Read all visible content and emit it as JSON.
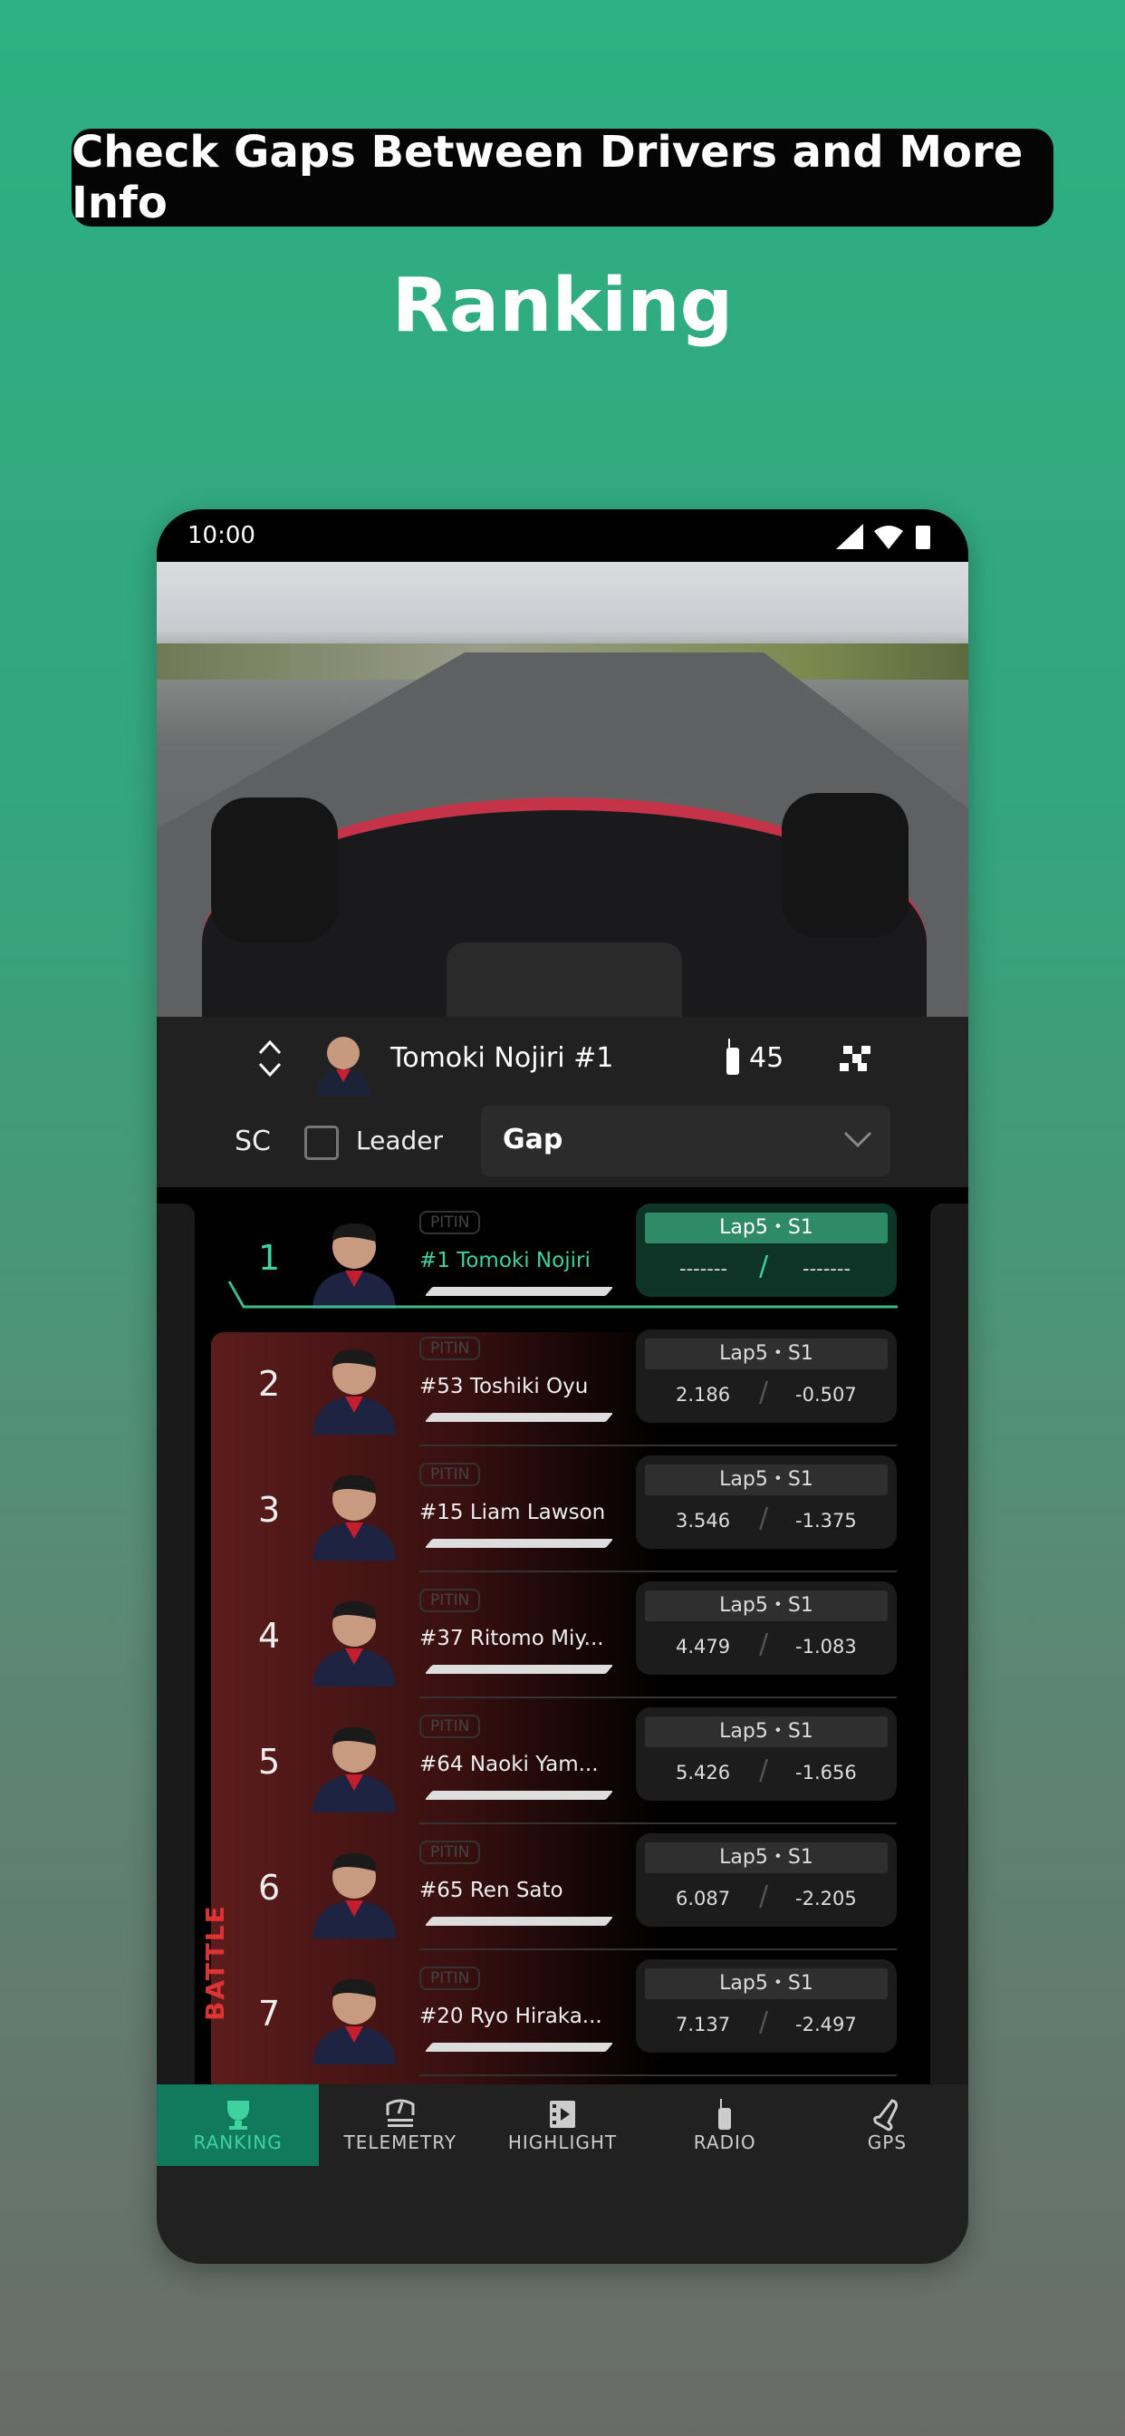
{
  "banner": "Check Gaps Between Drivers and More Info",
  "title": "Ranking",
  "status": {
    "time": "10:00"
  },
  "header": {
    "driver": "Tomoki Nojiri #1",
    "radio_count": "45"
  },
  "filter": {
    "sc": "SC",
    "leader": "Leader",
    "leader_checked": false,
    "mode": "Gap"
  },
  "battle_label": "BATTLE",
  "accent": "#2db083",
  "rows": [
    {
      "pos": "1",
      "pit": "PITIN",
      "name": "#1 Tomoki Nojiri",
      "lap": "Lap5・S1",
      "gap": "-------",
      "diff": "-------",
      "leader": true
    },
    {
      "pos": "2",
      "pit": "PITIN",
      "name": "#53 Toshiki Oyu",
      "lap": "Lap5・S1",
      "gap": "2.186",
      "diff": "-0.507"
    },
    {
      "pos": "3",
      "pit": "PITIN",
      "name": "#15 Liam Lawson",
      "lap": "Lap5・S1",
      "gap": "3.546",
      "diff": "-1.375"
    },
    {
      "pos": "4",
      "pit": "PITIN",
      "name": "#37 Ritomo Miy...",
      "lap": "Lap5・S1",
      "gap": "4.479",
      "diff": "-1.083"
    },
    {
      "pos": "5",
      "pit": "PITIN",
      "name": "#64 Naoki Yam...",
      "lap": "Lap5・S1",
      "gap": "5.426",
      "diff": "-1.656"
    },
    {
      "pos": "6",
      "pit": "PITIN",
      "name": "#65 Ren Sato",
      "lap": "Lap5・S1",
      "gap": "6.087",
      "diff": "-2.205"
    },
    {
      "pos": "7",
      "pit": "PITIN",
      "name": "#20 Ryo Hiraka...",
      "lap": "Lap5・S1",
      "gap": "7.137",
      "diff": "-2.497"
    }
  ],
  "nav": [
    {
      "label": "RANKING",
      "icon": "trophy-icon",
      "active": true
    },
    {
      "label": "TELEMETRY",
      "icon": "gauge-icon"
    },
    {
      "label": "HIGHLIGHT",
      "icon": "video-icon"
    },
    {
      "label": "RADIO",
      "icon": "radio-icon"
    },
    {
      "label": "GPS",
      "icon": "track-map-icon"
    }
  ]
}
